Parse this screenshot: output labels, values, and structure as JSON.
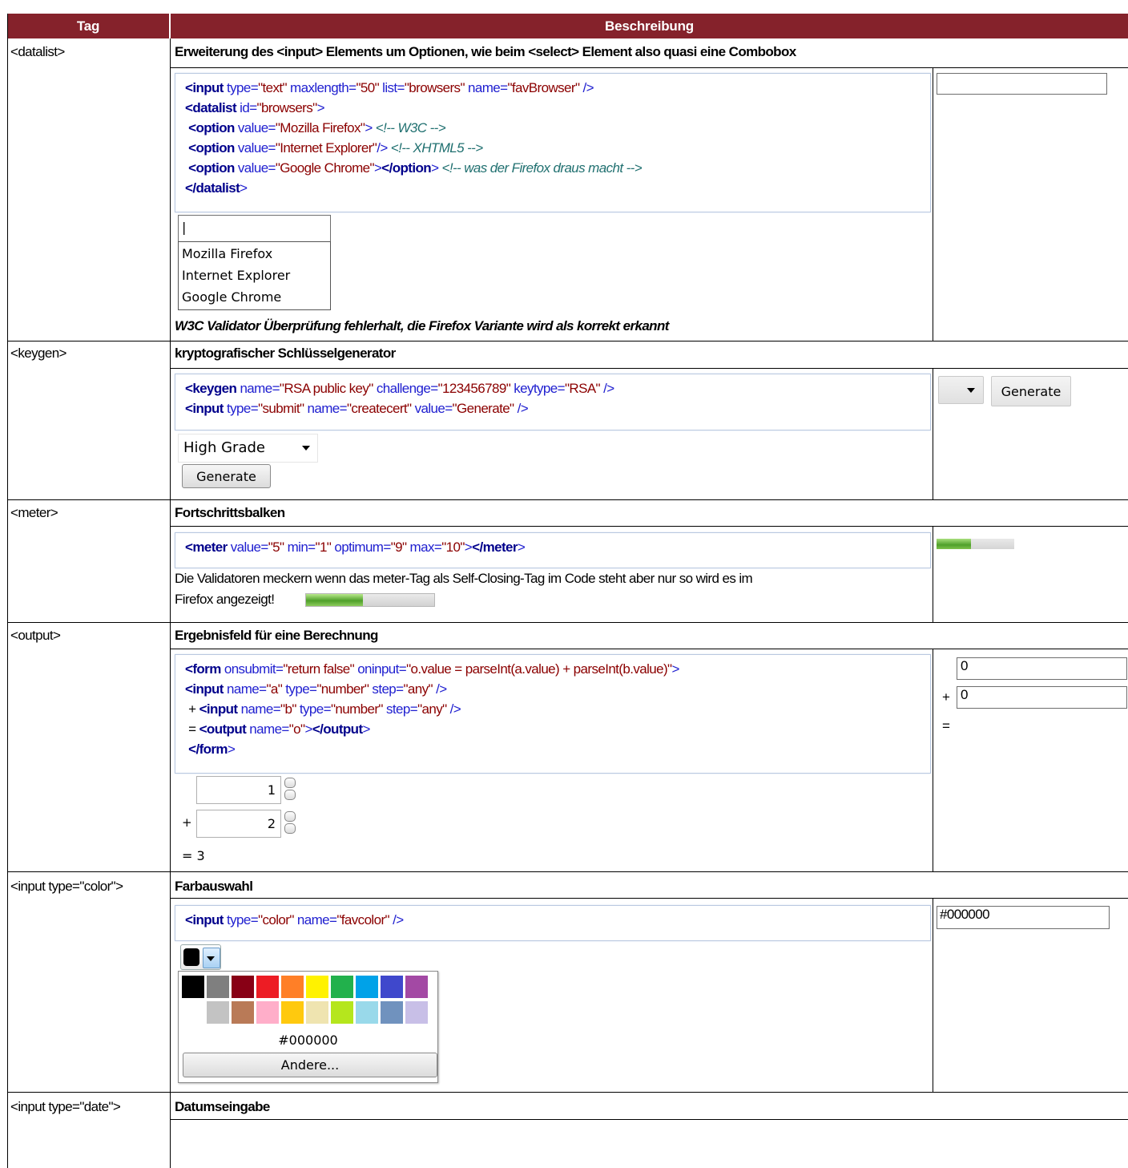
{
  "table": {
    "headers": {
      "tag": "Tag",
      "description": "Beschreibung"
    }
  },
  "datalist": {
    "tag": "<datalist>",
    "title": "Erweiterung des <input> Elements um Optionen, wie beim <select> Element also quasi eine Combobox",
    "code": [
      [
        [
          "kw",
          "<input"
        ],
        [
          "at",
          " type="
        ],
        [
          "st",
          "\"text\""
        ],
        [
          "at",
          " maxlength="
        ],
        [
          "st",
          "\"50\""
        ],
        [
          "at",
          " list="
        ],
        [
          "st",
          "\"browsers\""
        ],
        [
          "at",
          " name="
        ],
        [
          "st",
          "\"favBrowser\""
        ],
        [
          "at",
          " />"
        ]
      ],
      [
        [
          "kw",
          "<datalist"
        ],
        [
          "at",
          " id="
        ],
        [
          "st",
          "\"browsers\""
        ],
        [
          "at",
          ">"
        ]
      ],
      [
        [
          "pl",
          " "
        ],
        [
          "kw",
          "<option"
        ],
        [
          "at",
          " value="
        ],
        [
          "st",
          "\"Mozilla Firefox\""
        ],
        [
          "at",
          ">"
        ],
        [
          "cm",
          " <!-- W3C -->"
        ]
      ],
      [
        [
          "pl",
          " "
        ],
        [
          "kw",
          "<option"
        ],
        [
          "at",
          " value="
        ],
        [
          "st",
          "\"Internet Explorer\""
        ],
        [
          "at",
          "/>"
        ],
        [
          "cm",
          " <!-- XHTML5 -->"
        ]
      ],
      [
        [
          "pl",
          " "
        ],
        [
          "kw",
          "<option"
        ],
        [
          "at",
          " value="
        ],
        [
          "st",
          "\"Google Chrome\""
        ],
        [
          "at",
          ">"
        ],
        [
          "kw",
          "</option"
        ],
        [
          "at",
          ">"
        ],
        [
          "cm",
          " <!-- was der Firefox draus macht -->"
        ]
      ],
      [
        [
          "kw",
          "</datalist"
        ],
        [
          "at",
          ">"
        ]
      ]
    ],
    "input_value": "|",
    "options": [
      "Mozilla Firefox",
      "Internet Explorer",
      "Google Chrome"
    ],
    "note": "W3C Validator Überprüfung fehlerhalt, die Firefox Variante wird als korrekt erkannt",
    "live_input_value": ""
  },
  "keygen": {
    "tag": "<keygen>",
    "title": "kryptografischer Schlüsselgenerator",
    "code": [
      [
        [
          "kw",
          "<keygen"
        ],
        [
          "at",
          " name="
        ],
        [
          "st",
          "\"RSA public key\""
        ],
        [
          "at",
          " challenge="
        ],
        [
          "st",
          "\"123456789\""
        ],
        [
          "at",
          " keytype="
        ],
        [
          "st",
          "\"RSA\""
        ],
        [
          "at",
          " />"
        ]
      ],
      [
        [
          "kw",
          "<input"
        ],
        [
          "at",
          " type="
        ],
        [
          "st",
          "\"submit\""
        ],
        [
          "at",
          " name="
        ],
        [
          "st",
          "\"createcert\""
        ],
        [
          "at",
          " value="
        ],
        [
          "st",
          "\"Generate\""
        ],
        [
          "at",
          " />"
        ]
      ]
    ],
    "select_value": "High Grade",
    "button_label": "Generate",
    "live_button_label": "Generate"
  },
  "meter": {
    "tag": "<meter>",
    "title": "Fortschrittsbalken",
    "code": [
      [
        [
          "kw",
          "<meter"
        ],
        [
          "at",
          " value="
        ],
        [
          "st",
          "\"5\""
        ],
        [
          "at",
          " min="
        ],
        [
          "st",
          "\"1\""
        ],
        [
          "at",
          " optimum="
        ],
        [
          "st",
          "\"9\""
        ],
        [
          "at",
          " max="
        ],
        [
          "st",
          "\"10\""
        ],
        [
          "at",
          ">"
        ],
        [
          "kw",
          "</meter"
        ],
        [
          "at",
          ">"
        ]
      ]
    ],
    "note_line1": "Die Validatoren meckern wenn das meter-Tag als Self-Closing-Tag im Code steht aber nur so wird es im",
    "note_line2": "Firefox angezeigt!",
    "value": 5,
    "min": 1,
    "max": 10
  },
  "output": {
    "tag": "<output>",
    "title": "Ergebnisfeld für eine Berechnung",
    "code": [
      [
        [
          "kw",
          "<form"
        ],
        [
          "at",
          " onsubmit="
        ],
        [
          "st",
          "\"return false\""
        ],
        [
          "at",
          " oninput="
        ],
        [
          "st",
          "\"o.value = parseInt(a.value) + parseInt(b.value)\""
        ],
        [
          "at",
          ">"
        ]
      ],
      [
        [
          "kw",
          "<input"
        ],
        [
          "at",
          " name="
        ],
        [
          "st",
          "\"a\""
        ],
        [
          "at",
          " type="
        ],
        [
          "st",
          "\"number\""
        ],
        [
          "at",
          " step="
        ],
        [
          "st",
          "\"any\""
        ],
        [
          "at",
          " />"
        ]
      ],
      [
        [
          "pl",
          " + "
        ],
        [
          "kw",
          "<input"
        ],
        [
          "at",
          " name="
        ],
        [
          "st",
          "\"b\""
        ],
        [
          "at",
          " type="
        ],
        [
          "st",
          "\"number\""
        ],
        [
          "at",
          " step="
        ],
        [
          "st",
          "\"any\""
        ],
        [
          "at",
          " />"
        ]
      ],
      [
        [
          "pl",
          " = "
        ],
        [
          "kw",
          "<output"
        ],
        [
          "at",
          " name="
        ],
        [
          "st",
          "\"o\""
        ],
        [
          "at",
          ">"
        ],
        [
          "kw",
          "</output"
        ],
        [
          "at",
          ">"
        ]
      ],
      [
        [
          "pl",
          " "
        ],
        [
          "kw",
          "</form"
        ],
        [
          "at",
          ">"
        ]
      ]
    ],
    "a_value": "1",
    "b_value": "2",
    "plus": "+",
    "equals": "= 3",
    "live_a": "0",
    "live_b": "0",
    "live_plus": "+",
    "live_equals": "="
  },
  "color": {
    "tag": "<input type=\"color\">",
    "title": "Farbauswahl",
    "code": [
      [
        [
          "kw",
          "<input"
        ],
        [
          "at",
          " type="
        ],
        [
          "st",
          "\"color\""
        ],
        [
          "at",
          " name="
        ],
        [
          "st",
          "\"favcolor\""
        ],
        [
          "at",
          " />"
        ]
      ]
    ],
    "palette_row1": [
      "#000000",
      "#7f7f7f",
      "#880015",
      "#ed1c24",
      "#ff7f27",
      "#fff200",
      "#22b14c",
      "#00a2e8",
      "#3f48cc",
      "#a349a4"
    ],
    "palette_row2": [
      "#ffffff",
      "#c3c3c3",
      "#b97a57",
      "#ffaec9",
      "#ffc90e",
      "#efe4b0",
      "#b5e61d",
      "#99d9ea",
      "#7092be",
      "#c8bfe7"
    ],
    "hex_value": "#000000",
    "other_button": "Andere...",
    "live_value": "#000000"
  },
  "date": {
    "tag": "<input type=\"date\">",
    "title": "Datumseingabe"
  }
}
